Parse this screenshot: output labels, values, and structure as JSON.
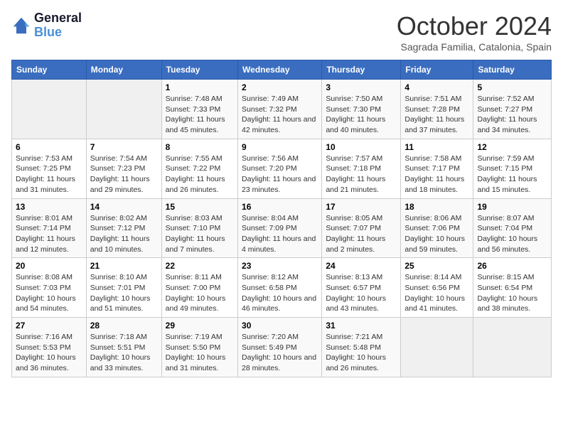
{
  "header": {
    "logo_line1": "General",
    "logo_line2": "Blue",
    "month_title": "October 2024",
    "subtitle": "Sagrada Familia, Catalonia, Spain"
  },
  "days_of_week": [
    "Sunday",
    "Monday",
    "Tuesday",
    "Wednesday",
    "Thursday",
    "Friday",
    "Saturday"
  ],
  "weeks": [
    [
      {
        "day": "",
        "info": ""
      },
      {
        "day": "",
        "info": ""
      },
      {
        "day": "1",
        "info": "Sunrise: 7:48 AM\nSunset: 7:33 PM\nDaylight: 11 hours and 45 minutes."
      },
      {
        "day": "2",
        "info": "Sunrise: 7:49 AM\nSunset: 7:32 PM\nDaylight: 11 hours and 42 minutes."
      },
      {
        "day": "3",
        "info": "Sunrise: 7:50 AM\nSunset: 7:30 PM\nDaylight: 11 hours and 40 minutes."
      },
      {
        "day": "4",
        "info": "Sunrise: 7:51 AM\nSunset: 7:28 PM\nDaylight: 11 hours and 37 minutes."
      },
      {
        "day": "5",
        "info": "Sunrise: 7:52 AM\nSunset: 7:27 PM\nDaylight: 11 hours and 34 minutes."
      }
    ],
    [
      {
        "day": "6",
        "info": "Sunrise: 7:53 AM\nSunset: 7:25 PM\nDaylight: 11 hours and 31 minutes."
      },
      {
        "day": "7",
        "info": "Sunrise: 7:54 AM\nSunset: 7:23 PM\nDaylight: 11 hours and 29 minutes."
      },
      {
        "day": "8",
        "info": "Sunrise: 7:55 AM\nSunset: 7:22 PM\nDaylight: 11 hours and 26 minutes."
      },
      {
        "day": "9",
        "info": "Sunrise: 7:56 AM\nSunset: 7:20 PM\nDaylight: 11 hours and 23 minutes."
      },
      {
        "day": "10",
        "info": "Sunrise: 7:57 AM\nSunset: 7:18 PM\nDaylight: 11 hours and 21 minutes."
      },
      {
        "day": "11",
        "info": "Sunrise: 7:58 AM\nSunset: 7:17 PM\nDaylight: 11 hours and 18 minutes."
      },
      {
        "day": "12",
        "info": "Sunrise: 7:59 AM\nSunset: 7:15 PM\nDaylight: 11 hours and 15 minutes."
      }
    ],
    [
      {
        "day": "13",
        "info": "Sunrise: 8:01 AM\nSunset: 7:14 PM\nDaylight: 11 hours and 12 minutes."
      },
      {
        "day": "14",
        "info": "Sunrise: 8:02 AM\nSunset: 7:12 PM\nDaylight: 11 hours and 10 minutes."
      },
      {
        "day": "15",
        "info": "Sunrise: 8:03 AM\nSunset: 7:10 PM\nDaylight: 11 hours and 7 minutes."
      },
      {
        "day": "16",
        "info": "Sunrise: 8:04 AM\nSunset: 7:09 PM\nDaylight: 11 hours and 4 minutes."
      },
      {
        "day": "17",
        "info": "Sunrise: 8:05 AM\nSunset: 7:07 PM\nDaylight: 11 hours and 2 minutes."
      },
      {
        "day": "18",
        "info": "Sunrise: 8:06 AM\nSunset: 7:06 PM\nDaylight: 10 hours and 59 minutes."
      },
      {
        "day": "19",
        "info": "Sunrise: 8:07 AM\nSunset: 7:04 PM\nDaylight: 10 hours and 56 minutes."
      }
    ],
    [
      {
        "day": "20",
        "info": "Sunrise: 8:08 AM\nSunset: 7:03 PM\nDaylight: 10 hours and 54 minutes."
      },
      {
        "day": "21",
        "info": "Sunrise: 8:10 AM\nSunset: 7:01 PM\nDaylight: 10 hours and 51 minutes."
      },
      {
        "day": "22",
        "info": "Sunrise: 8:11 AM\nSunset: 7:00 PM\nDaylight: 10 hours and 49 minutes."
      },
      {
        "day": "23",
        "info": "Sunrise: 8:12 AM\nSunset: 6:58 PM\nDaylight: 10 hours and 46 minutes."
      },
      {
        "day": "24",
        "info": "Sunrise: 8:13 AM\nSunset: 6:57 PM\nDaylight: 10 hours and 43 minutes."
      },
      {
        "day": "25",
        "info": "Sunrise: 8:14 AM\nSunset: 6:56 PM\nDaylight: 10 hours and 41 minutes."
      },
      {
        "day": "26",
        "info": "Sunrise: 8:15 AM\nSunset: 6:54 PM\nDaylight: 10 hours and 38 minutes."
      }
    ],
    [
      {
        "day": "27",
        "info": "Sunrise: 7:16 AM\nSunset: 5:53 PM\nDaylight: 10 hours and 36 minutes."
      },
      {
        "day": "28",
        "info": "Sunrise: 7:18 AM\nSunset: 5:51 PM\nDaylight: 10 hours and 33 minutes."
      },
      {
        "day": "29",
        "info": "Sunrise: 7:19 AM\nSunset: 5:50 PM\nDaylight: 10 hours and 31 minutes."
      },
      {
        "day": "30",
        "info": "Sunrise: 7:20 AM\nSunset: 5:49 PM\nDaylight: 10 hours and 28 minutes."
      },
      {
        "day": "31",
        "info": "Sunrise: 7:21 AM\nSunset: 5:48 PM\nDaylight: 10 hours and 26 minutes."
      },
      {
        "day": "",
        "info": ""
      },
      {
        "day": "",
        "info": ""
      }
    ]
  ]
}
